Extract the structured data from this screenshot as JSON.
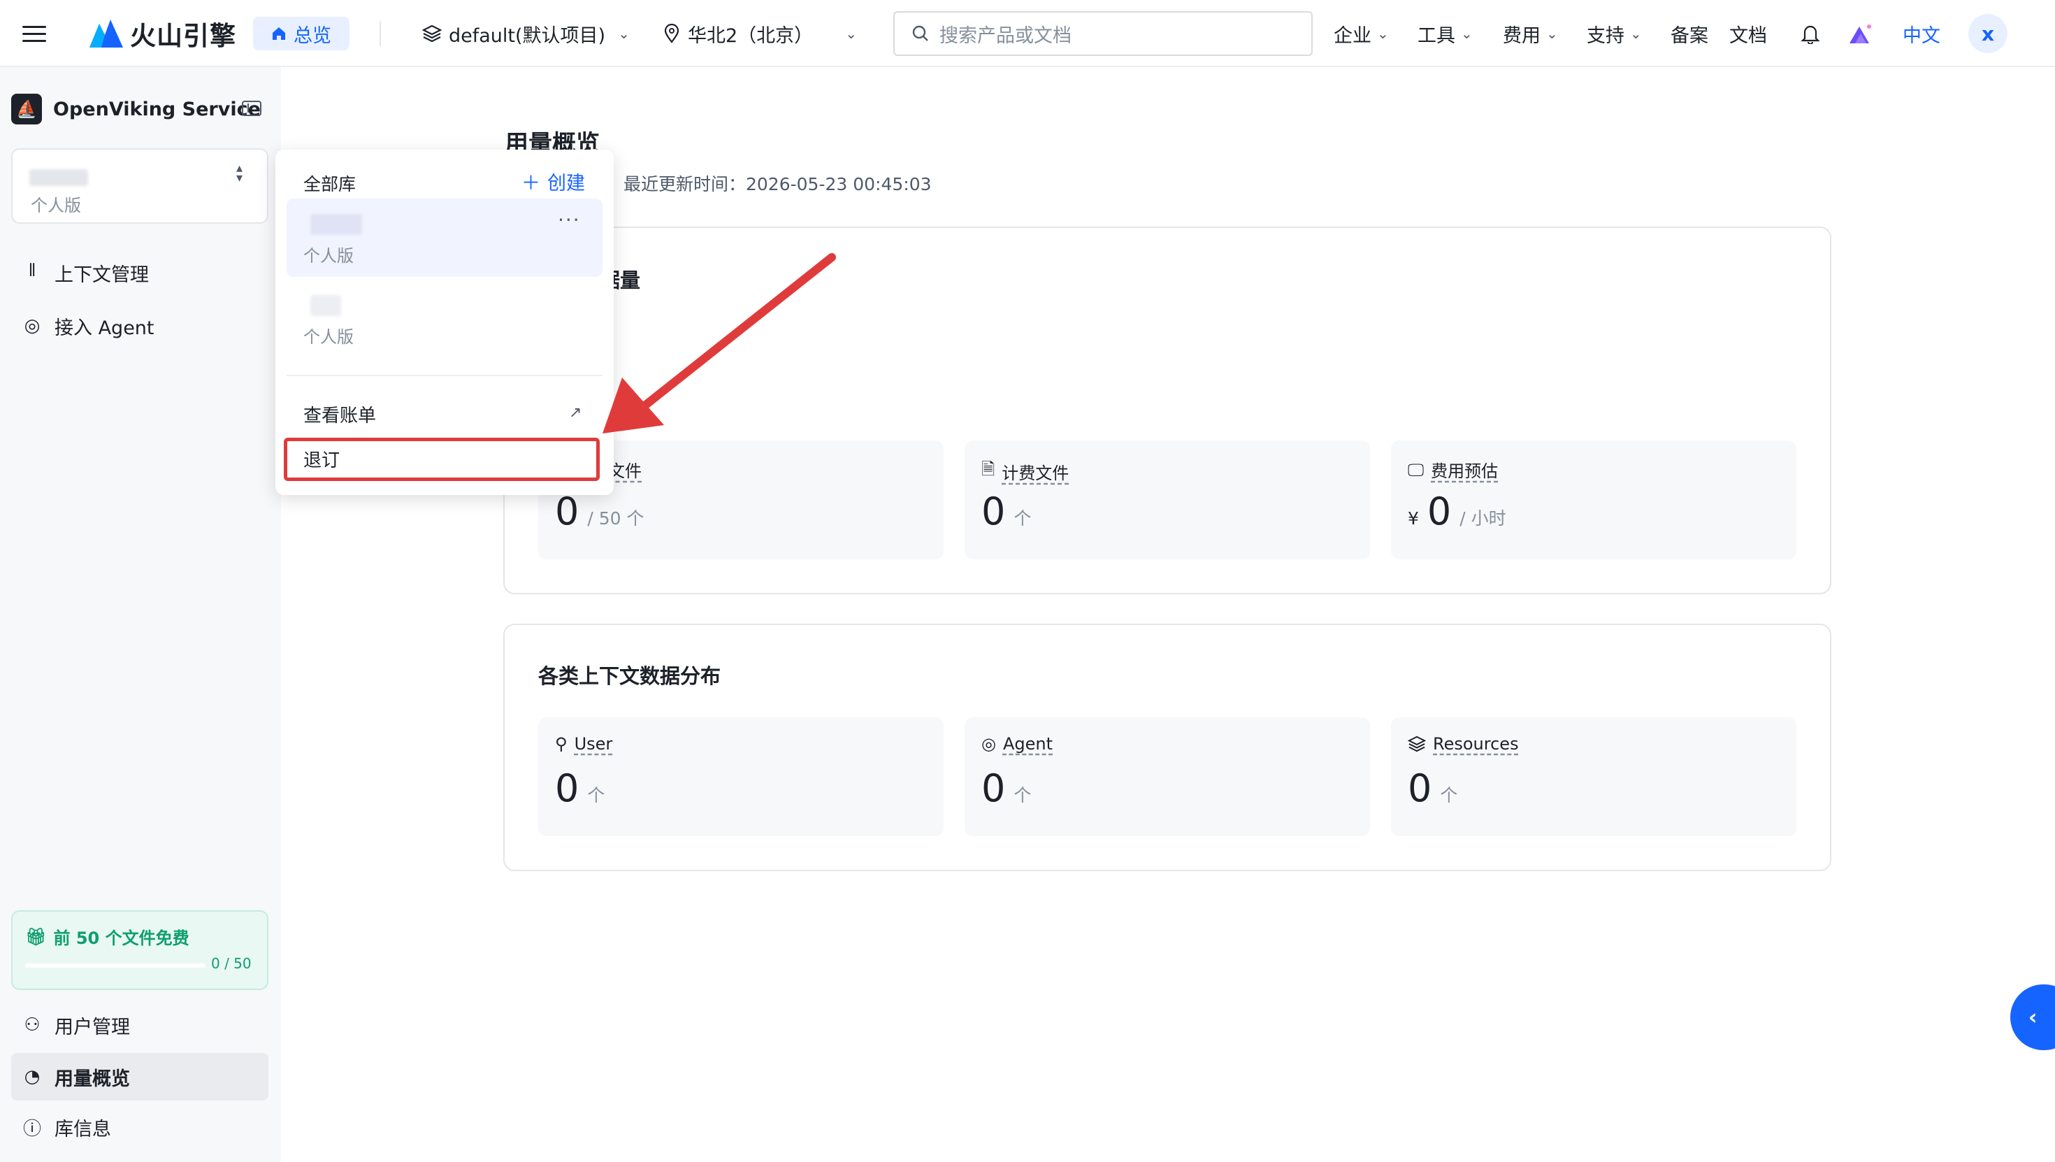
{
  "topbar": {
    "brand": "火山引擎",
    "home_label": "总览",
    "project": "default(默认项目)",
    "region": "华北2（北京）",
    "search_placeholder": "搜索产品或文档",
    "menus": [
      "企业",
      "工具",
      "费用",
      "支持"
    ],
    "links": [
      "备案",
      "文档"
    ],
    "language": "中文",
    "user_initial": "x",
    "icons": {
      "menu": "hamburger-icon",
      "home": "home-icon",
      "project": "layers-icon",
      "region": "location-pin-icon",
      "search": "search-icon",
      "notify": "bell-icon",
      "ai": "ai-assistant-icon"
    }
  },
  "sidebar": {
    "service_name": "OpenViking Service",
    "library_plan": "个人版",
    "nav_top": [
      {
        "label": "上下文管理",
        "icon": "books-icon"
      },
      {
        "label": "接入 Agent",
        "icon": "robot-icon"
      }
    ],
    "free_banner": {
      "title": "前 50 个文件免费",
      "count": "0 / 50",
      "progress": 0
    },
    "nav_bottom": [
      {
        "label": "用户管理",
        "icon": "user-manage-icon"
      },
      {
        "label": "用量概览",
        "icon": "pie-chart-icon",
        "active": true
      },
      {
        "label": "库信息",
        "icon": "info-icon"
      }
    ]
  },
  "main": {
    "title": "用量概览",
    "update_time": "最近更新时间：2026-05-23 00:45:03",
    "section1": {
      "title": "据量",
      "stats": [
        {
          "label": "文件",
          "value": "0",
          "unit": "/ 50 个"
        },
        {
          "label": "计费文件",
          "value": "0",
          "unit": "个",
          "icon": "file-bill-icon"
        },
        {
          "label": "费用预估",
          "prefix": "¥",
          "value": "0",
          "unit": "/ 小时",
          "icon": "cost-monitor-icon"
        }
      ]
    },
    "section2": {
      "title": "各类上下文数据分布",
      "stats": [
        {
          "label": "User",
          "value": "0",
          "unit": "个",
          "icon": "user-icon"
        },
        {
          "label": "Agent",
          "value": "0",
          "unit": "个",
          "icon": "robot-icon"
        },
        {
          "label": "Resources",
          "value": "0",
          "unit": "个",
          "icon": "layers-icon"
        }
      ]
    }
  },
  "dropdown": {
    "header": "全部库",
    "create_label": "创建",
    "items": [
      {
        "plan": "个人版",
        "selected": true
      },
      {
        "plan": "个人版",
        "selected": false
      }
    ],
    "view_bill": "查看账单",
    "unsubscribe": "退订"
  },
  "colors": {
    "primary": "#1664ff",
    "annotation": "#e03b3b",
    "free_green": "#0e9f6e"
  }
}
